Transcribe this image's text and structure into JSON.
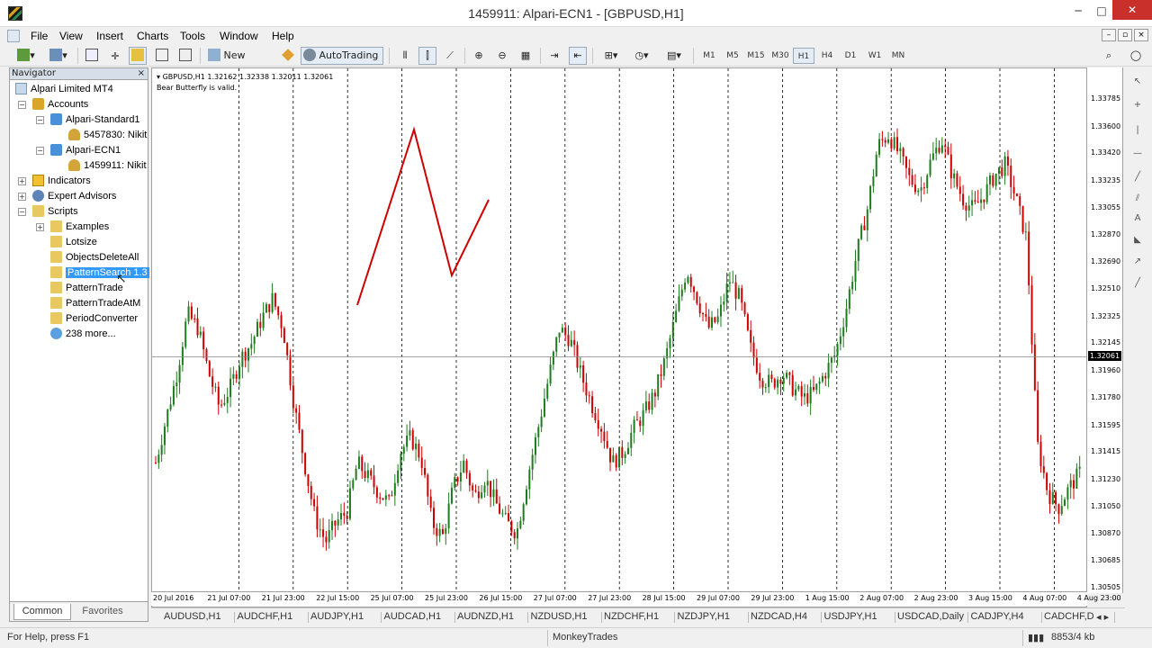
{
  "window": {
    "title": "1459911: Alpari-ECN1 - [GBPUSD,H1]",
    "minimize": "─",
    "maximize": "□",
    "close": "✕"
  },
  "menu": [
    "File",
    "View",
    "Insert",
    "Charts",
    "Tools",
    "Window",
    "Help"
  ],
  "toolbar": {
    "new_order": "New Order",
    "auto_trading": "AutoTrading",
    "timeframes": [
      "M1",
      "M5",
      "M15",
      "M30",
      "H1",
      "H4",
      "D1",
      "W1",
      "MN"
    ],
    "active_timeframe": "H1"
  },
  "navigator": {
    "title": "Navigator",
    "close": "×",
    "items": [
      {
        "label": "Alpari Limited MT4",
        "icon": "mt4-icon"
      },
      {
        "label": "Accounts",
        "icon": "accounts-icon"
      },
      {
        "label": "Alpari-Standard1",
        "icon": "server-icon"
      },
      {
        "label": "5457830: Nikit",
        "icon": "user-icon"
      },
      {
        "label": "Alpari-ECN1",
        "icon": "server-icon"
      },
      {
        "label": "1459911: Nikit",
        "icon": "user-icon"
      },
      {
        "label": "Indicators",
        "icon": "indicators-icon"
      },
      {
        "label": "Expert Advisors",
        "icon": "expert-advisors-icon"
      },
      {
        "label": "Scripts",
        "icon": "scripts-icon"
      },
      {
        "label": "Examples",
        "icon": "script-icon"
      },
      {
        "label": "Lotsize",
        "icon": "script-icon"
      },
      {
        "label": "ObjectsDeleteAll",
        "icon": "script-icon"
      },
      {
        "label": "PatternSearch 1.3",
        "icon": "script-icon"
      },
      {
        "label": "PatternTrade",
        "icon": "script-icon"
      },
      {
        "label": "PatternTradeAtM",
        "icon": "script-icon"
      },
      {
        "label": "PeriodConverter",
        "icon": "script-icon"
      },
      {
        "label": "238 more...",
        "icon": "globe-icon"
      }
    ],
    "tabs": [
      "Common",
      "Favorites"
    ]
  },
  "chart": {
    "info_line": "GBPUSD,H1  1.32162 1.32338 1.32011 1.32061",
    "message": "Bear Butterfly is valid.",
    "current_price": "1.32061",
    "colors": {
      "bull": "#1e7b1e",
      "bear": "#cc0000",
      "pattern": "#cc0000"
    }
  },
  "chart_data": {
    "type": "candlestick",
    "symbol": "GBPUSD",
    "timeframe": "H1",
    "ylim": [
      1.30505,
      1.33875
    ],
    "y_ticks": [
      "1.33785",
      "1.33600",
      "1.33420",
      "1.33235",
      "1.33055",
      "1.32870",
      "1.32690",
      "1.32510",
      "1.32325",
      "1.32145",
      "1.31960",
      "1.31780",
      "1.31595",
      "1.31415",
      "1.31230",
      "1.31050",
      "1.30870",
      "1.30685",
      "1.30505"
    ],
    "y_tick_values": [
      1.33785,
      1.336,
      1.3342,
      1.33235,
      1.33055,
      1.3287,
      1.3269,
      1.3251,
      1.32325,
      1.32145,
      1.3196,
      1.3178,
      1.31595,
      1.31415,
      1.3123,
      1.3105,
      1.3087,
      1.30685,
      1.30505
    ],
    "x_ticks": [
      "20 Jul 2016",
      "21 Jul 07:00",
      "21 Jul 23:00",
      "22 Jul 15:00",
      "25 Jul 07:00",
      "25 Jul 23:00",
      "26 Jul 15:00",
      "27 Jul 07:00",
      "27 Jul 23:00",
      "28 Jul 15:00",
      "29 Jul 07:00",
      "29 Jul 23:00",
      "1 Aug 15:00",
      "2 Aug 07:00",
      "2 Aug 23:00",
      "3 Aug 15:00",
      "4 Aug 07:00",
      "4 Aug 23:00"
    ],
    "close_path": [
      1.3135,
      1.3165,
      1.3195,
      1.3235,
      1.3225,
      1.3195,
      1.3172,
      1.3185,
      1.3205,
      1.3215,
      1.3232,
      1.3245,
      1.3225,
      1.3175,
      1.3135,
      1.3098,
      1.3082,
      1.3095,
      1.3102,
      1.3135,
      1.3125,
      1.3115,
      1.3108,
      1.3142,
      1.3152,
      1.3138,
      1.3095,
      1.3085,
      1.3118,
      1.3135,
      1.3112,
      1.3125,
      1.3108,
      1.3095,
      1.3088,
      1.3125,
      1.3158,
      1.3192,
      1.3225,
      1.3218,
      1.3195,
      1.3175,
      1.3158,
      1.3135,
      1.3142,
      1.3158,
      1.3168,
      1.3182,
      1.3205,
      1.3235,
      1.3265,
      1.3245,
      1.3225,
      1.3232,
      1.3258,
      1.3245,
      1.3212,
      1.3192,
      1.3188,
      1.3195,
      1.3185,
      1.3178,
      1.3182,
      1.3195,
      1.3208,
      1.3238,
      1.3275,
      1.3305,
      1.3348,
      1.3355,
      1.3342,
      1.3325,
      1.3318,
      1.3338,
      1.3352,
      1.3328,
      1.3312,
      1.3305,
      1.3315,
      1.3328,
      1.3335,
      1.3312,
      1.3285,
      1.3148,
      1.3115,
      1.3105,
      1.3118,
      1.3128
    ]
  },
  "symbol_tabs": [
    "AUDUSD,H1",
    "AUDCHF,H1",
    "AUDJPY,H1",
    "AUDCAD,H1",
    "AUDNZD,H1",
    "NZDUSD,H1",
    "NZDCHF,H1",
    "NZDJPY,H1",
    "NZDCAD,H4",
    "USDJPY,H1",
    "USDCAD,Daily",
    "CADJPY,H4",
    "CADCHF,D"
  ],
  "status": {
    "help": "For Help, press F1",
    "profile": "MonkeyTrades",
    "traffic": "8853/4 kb"
  }
}
